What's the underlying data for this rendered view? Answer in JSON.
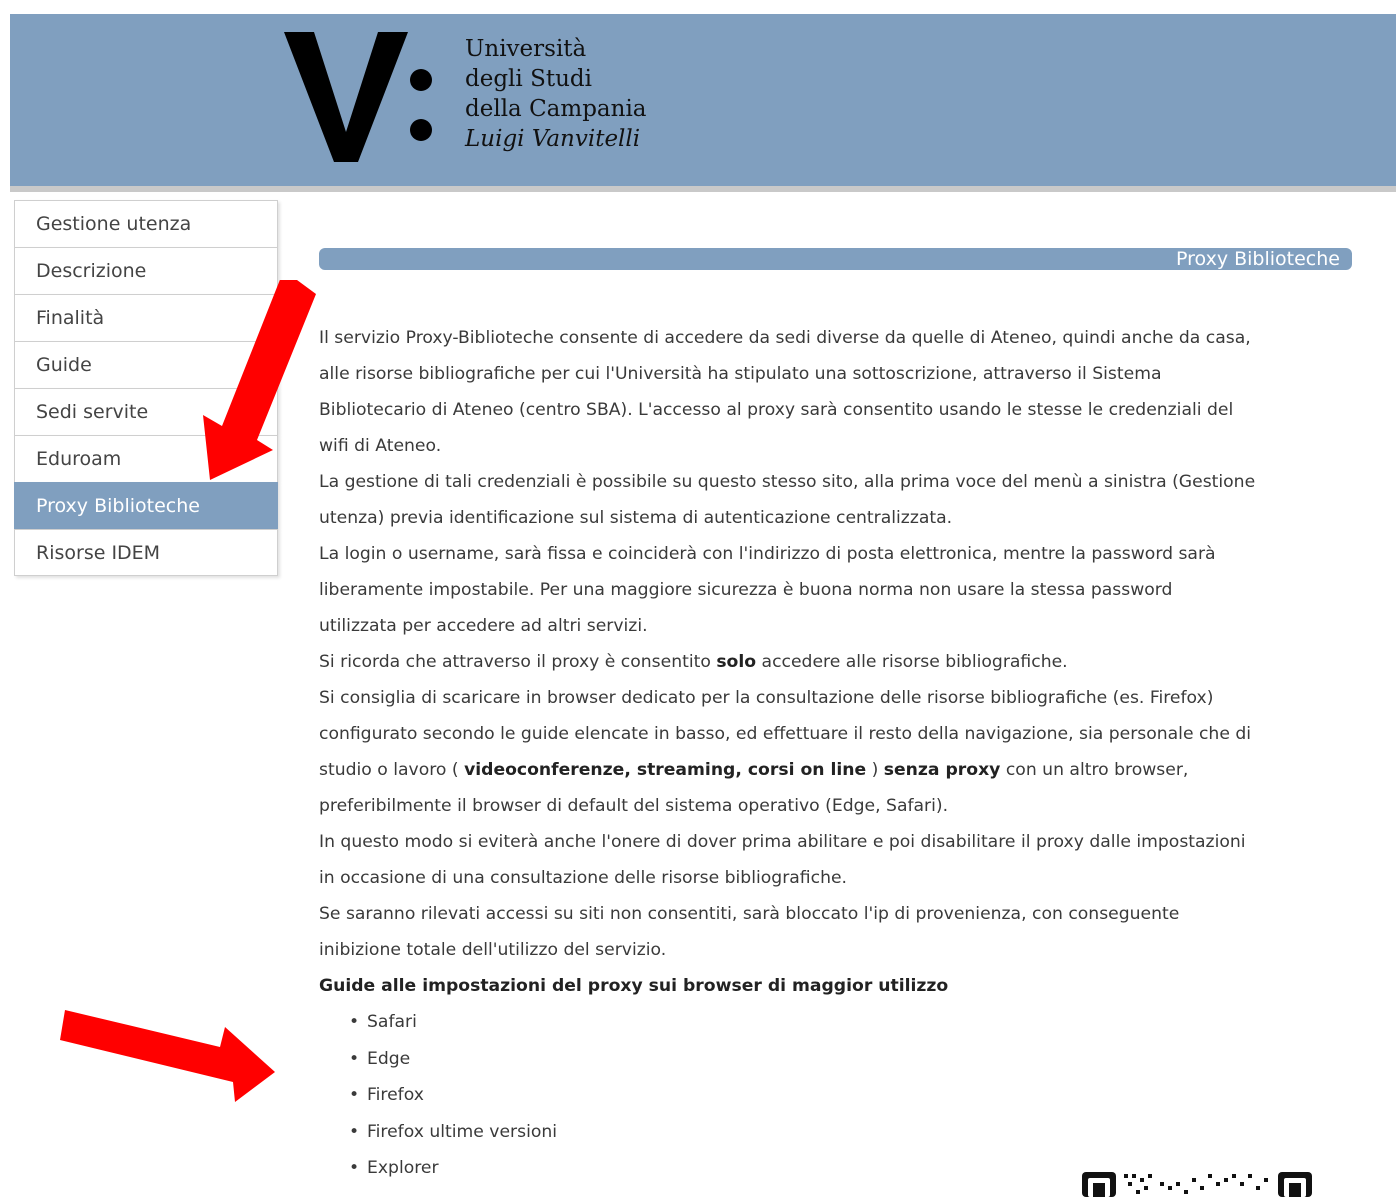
{
  "header": {
    "logo_letter": "V",
    "logo_lines": [
      "Università",
      "degli Studi",
      "della Campania"
    ],
    "logo_subtitle": "Luigi Vanvitelli",
    "background": "#809fbf"
  },
  "sidebar": {
    "items": [
      {
        "label": "Gestione utenza",
        "active": false
      },
      {
        "label": "Descrizione",
        "active": false
      },
      {
        "label": "Finalità",
        "active": false
      },
      {
        "label": "Guide",
        "active": false
      },
      {
        "label": "Sedi servite",
        "active": false
      },
      {
        "label": "Eduroam",
        "active": false
      },
      {
        "label": "Proxy Biblioteche",
        "active": true
      },
      {
        "label": "Risorse IDEM",
        "active": false
      }
    ]
  },
  "main": {
    "section_title": "Proxy Biblioteche",
    "lines": {
      "l1": "Il servizio Proxy-Biblioteche consente di accedere da sedi diverse da quelle di Ateneo, quindi anche da casa,",
      "l2": "alle risorse bibliografiche per cui l'Università ha stipulato una sottoscrizione, attraverso il Sistema",
      "l3": "Bibliotecario di Ateneo (centro SBA). L'accesso al proxy sarà consentito usando le stesse le credenziali del",
      "l4": "wifi di Ateneo.",
      "l5": "La gestione di tali credenziali è possibile su questo stesso sito, alla prima voce del menù a sinistra (Gestione",
      "l6": "utenza) previa identificazione sul sistema di autenticazione centralizzata.",
      "l7": "La login o username, sarà fissa e coinciderà con l'indirizzo di posta elettronica, mentre la password sarà",
      "l8": "liberamente impostabile. Per una maggiore sicurezza è buona norma non usare la stessa password",
      "l9": "utilizzata per accedere ad altri servizi.",
      "l10a": "Si ricorda che attraverso il proxy è consentito ",
      "l10b": "solo",
      "l10c": " accedere alle risorse bibliografiche.",
      "l11": "Si consiglia di scaricare in browser dedicato per la consultazione delle risorse bibliografiche (es. Firefox)",
      "l12": "configurato secondo le guide elencate in basso, ed effettuare il resto della navigazione, sia personale che di",
      "l13a": "studio o lavoro ( ",
      "l13b": "videoconferenze, streaming, corsi on line",
      "l13c": " ) ",
      "l13d": "senza proxy",
      "l13e": " con un altro browser,",
      "l14": "preferibilmente il browser di default del sistema operativo (Edge, Safari).",
      "l15": "In questo modo si eviterà anche l'onere di dover prima abilitare e poi disabilitare il proxy dalle impostazioni",
      "l16": "in occasione di una consultazione delle risorse bibliografiche.",
      "l17": "Se saranno rilevati accessi su siti non consentiti, sarà bloccato l'ip di provenienza, con conseguente",
      "l18": "inibizione totale dell'utilizzo del servizio."
    },
    "guides_title": "Guide alle impostazioni del proxy sui browser di maggior utilizzo",
    "guides": [
      "Safari",
      "Edge",
      "Firefox",
      "Firefox ultime versioni",
      "Explorer"
    ]
  },
  "annotation_color": "#ff0000"
}
